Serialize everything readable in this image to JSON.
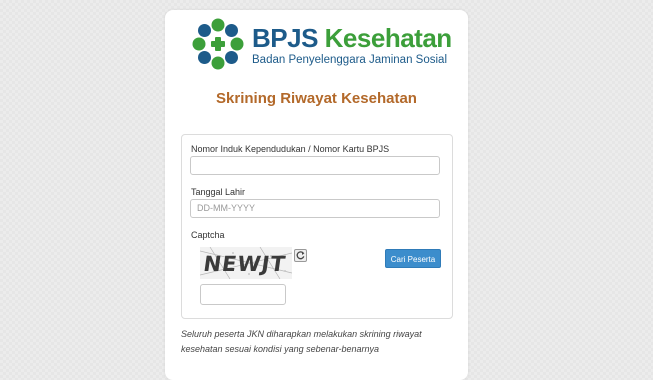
{
  "brand": {
    "name_part1": "BPJS",
    "name_part2": "Kesehatan",
    "tagline": "Badan Penyelenggara Jaminan Sosial",
    "logo_icon": "bpjs-logo-icon",
    "colors": {
      "blue": "#1d5b8a",
      "green": "#3c9f3a"
    }
  },
  "page_title": "Skrining Riwayat Kesehatan",
  "form": {
    "nik_label": "Nomor Induk Kependudukan / Nomor Kartu BPJS",
    "nik_value": "",
    "dob_label": "Tanggal Lahir",
    "dob_placeholder": "DD-MM-YYYY",
    "captcha_label": "Captcha",
    "captcha_text": "NEWJT",
    "captcha_input_value": "",
    "submit_label": "Cari Peserta",
    "refresh_icon": "refresh-icon"
  },
  "note": "Seluruh peserta JKN diharapkan melakukan skrining riwayat kesehatan sesuai kondisi yang sebenar-benarnya",
  "colors": {
    "title": "#b3692a",
    "button": "#3c8dcc"
  }
}
